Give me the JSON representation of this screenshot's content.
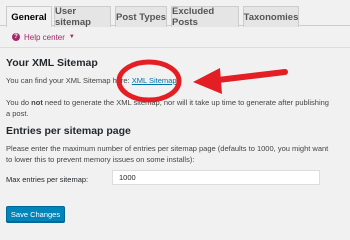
{
  "tabs": [
    {
      "label": "General",
      "active": true
    },
    {
      "label": "User sitemap",
      "active": false
    },
    {
      "label": "Post Types",
      "active": false
    },
    {
      "label": "Excluded Posts",
      "active": false
    },
    {
      "label": "Taxonomies",
      "active": false
    }
  ],
  "help": {
    "label": "Help center",
    "icon": "question-icon"
  },
  "xml_section": {
    "title": "Your XML Sitemap",
    "find_prefix": "You can find your XML Sitemap here: ",
    "link_text": "XML Sitemap",
    "note_line1_a": "You do ",
    "note_line1_bold": "not",
    "note_line1_b": " need to generate the XML sitemap, nor will it take up time to generate after publishing",
    "note_line2": "a post."
  },
  "entries_section": {
    "title": "Entries per sitemap page",
    "desc_line1": "Please enter the maximum number of entries per sitemap page (defaults to 1000, you might want",
    "desc_line2": "to lower this to prevent memory issues on some installs):",
    "field_label": "Max entries per sitemap:",
    "field_value": "1000"
  },
  "save_button": {
    "label": "Save Changes"
  },
  "colors": {
    "accent_red": "#e31e24",
    "button_blue": "#0085ba",
    "link_blue": "#0073aa",
    "help_purple": "#a4286a"
  }
}
